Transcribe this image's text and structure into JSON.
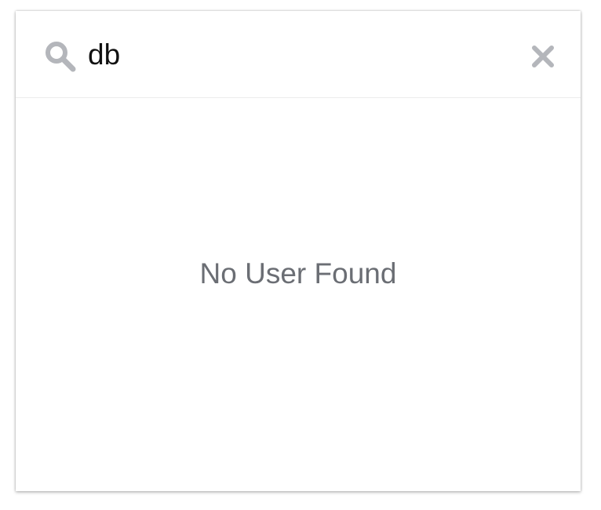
{
  "search": {
    "value": "db",
    "icon": "search-icon",
    "clear_icon": "close-icon"
  },
  "results": {
    "empty_message": "No User Found"
  },
  "colors": {
    "icon_gray": "#b4b6bb",
    "message_gray": "#6b6e74",
    "divider": "#ececec"
  }
}
